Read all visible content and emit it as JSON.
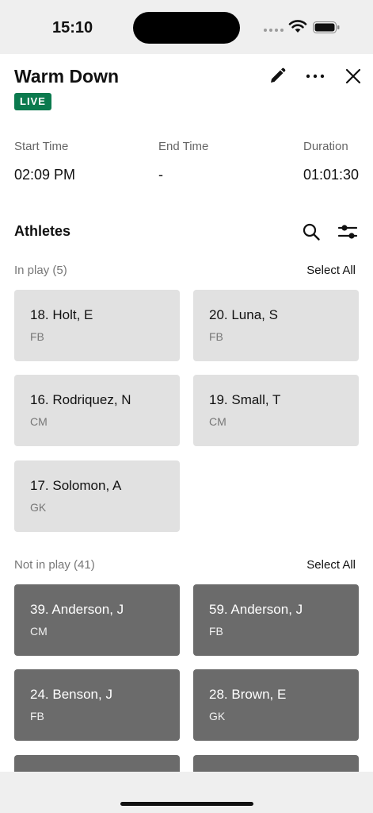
{
  "status": {
    "time": "15:10"
  },
  "header": {
    "title": "Warm Down",
    "badge": "LIVE"
  },
  "times": {
    "start_label": "Start Time",
    "start_value": "02:09 PM",
    "end_label": "End Time",
    "end_value": "-",
    "duration_label": "Duration",
    "duration_value": "01:01:30"
  },
  "athletes": {
    "title": "Athletes",
    "in_play": {
      "label": "In play (5)",
      "select_all": "Select All",
      "items": [
        {
          "name": "18. Holt, E",
          "position": "FB"
        },
        {
          "name": "20. Luna, S",
          "position": "FB"
        },
        {
          "name": "16. Rodriquez, N",
          "position": "CM"
        },
        {
          "name": "19. Small, T",
          "position": "CM"
        },
        {
          "name": "17. Solomon, A",
          "position": "GK"
        }
      ]
    },
    "not_in_play": {
      "label": "Not in play (41)",
      "select_all": "Select All",
      "items": [
        {
          "name": "39. Anderson, J",
          "position": "CM"
        },
        {
          "name": "59. Anderson, J",
          "position": "FB"
        },
        {
          "name": "24. Benson, J",
          "position": "FB"
        },
        {
          "name": "28. Brown, E",
          "position": "GK"
        }
      ]
    }
  },
  "icons": [
    "edit-icon",
    "more-icon",
    "close-icon",
    "search-icon",
    "filter-icon",
    "wifi-icon",
    "battery-icon"
  ],
  "colors": {
    "live_badge": "#0b7a4e",
    "in_play_card": "#e1e1e1",
    "not_in_play_card": "#6b6b6b"
  }
}
